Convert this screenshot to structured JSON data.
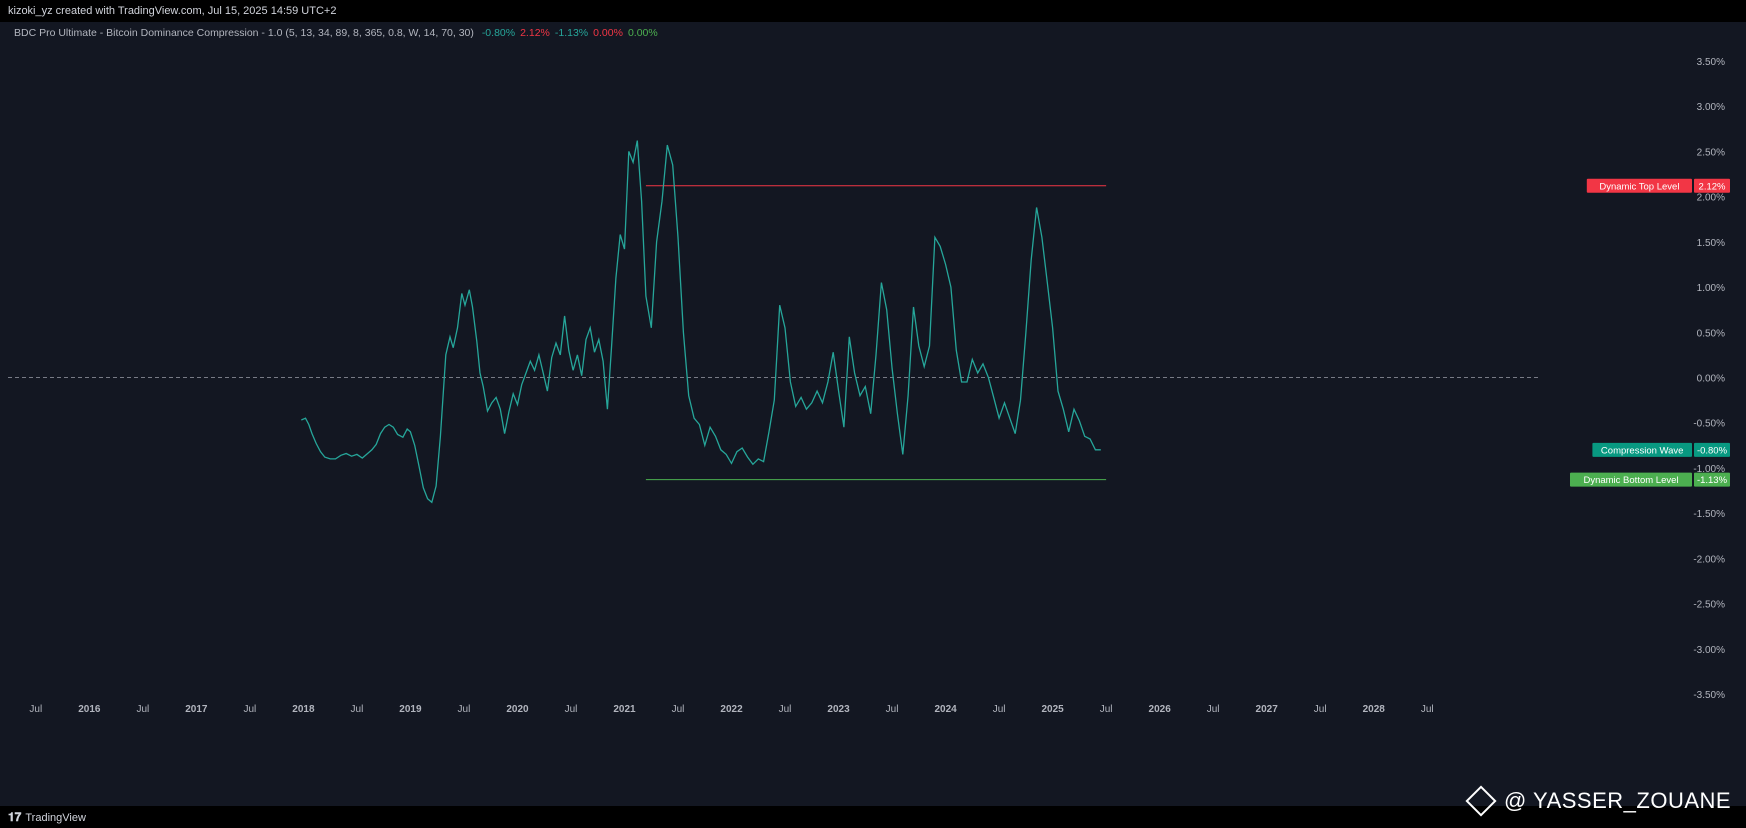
{
  "header": {
    "text": "kizoki_yz created with TradingView.com, Jul 15, 2025 14:59 UTC+2"
  },
  "legend": {
    "title": "BDC Pro Ultimate - Bitcoin Dominance Compression - 1.0 (5, 13, 34, 89, 8, 365, 0.8, W, 14, 70, 30)",
    "values": [
      {
        "text": "-0.80%",
        "color": "#26a69a"
      },
      {
        "text": "2.12%",
        "color": "#f23645"
      },
      {
        "text": "-1.13%",
        "color": "#26a69a"
      },
      {
        "text": "0.00%",
        "color": "#f23645"
      },
      {
        "text": "0.00%",
        "color": "#4caf50"
      }
    ]
  },
  "footer": {
    "logo_text": "TradingView",
    "icon": "tradingview-logo-icon"
  },
  "watermark": {
    "text": "@ YASSER_ZOUANE",
    "icon": "binance-logo-icon"
  },
  "chart_data": {
    "type": "line",
    "ylim": [
      -3.5,
      3.5
    ],
    "y_ticks": [
      "3.50%",
      "3.00%",
      "2.50%",
      "2.00%",
      "1.50%",
      "1.00%",
      "0.50%",
      "0.00%",
      "-0.50%",
      "-1.00%",
      "-1.50%",
      "-2.00%",
      "-2.50%",
      "-3.00%",
      "-3.50%"
    ],
    "x_ticks": [
      {
        "label": "Jul",
        "t": 2015.5
      },
      {
        "label": "2016",
        "t": 2016.0
      },
      {
        "label": "Jul",
        "t": 2016.5
      },
      {
        "label": "2017",
        "t": 2017.0
      },
      {
        "label": "Jul",
        "t": 2017.5
      },
      {
        "label": "2018",
        "t": 2018.0
      },
      {
        "label": "Jul",
        "t": 2018.5
      },
      {
        "label": "2019",
        "t": 2019.0
      },
      {
        "label": "Jul",
        "t": 2019.5
      },
      {
        "label": "2020",
        "t": 2020.0
      },
      {
        "label": "Jul",
        "t": 2020.5
      },
      {
        "label": "2021",
        "t": 2021.0
      },
      {
        "label": "Jul",
        "t": 2021.5
      },
      {
        "label": "2022",
        "t": 2022.0
      },
      {
        "label": "Jul",
        "t": 2022.5
      },
      {
        "label": "2023",
        "t": 2023.0
      },
      {
        "label": "Jul",
        "t": 2023.5
      },
      {
        "label": "2024",
        "t": 2024.0
      },
      {
        "label": "Jul",
        "t": 2024.5
      },
      {
        "label": "2025",
        "t": 2025.0
      },
      {
        "label": "Jul",
        "t": 2025.5
      },
      {
        "label": "2026",
        "t": 2026.0
      },
      {
        "label": "Jul",
        "t": 2026.5
      },
      {
        "label": "2027",
        "t": 2027.0
      },
      {
        "label": "Jul",
        "t": 2027.5
      },
      {
        "label": "2028",
        "t": 2028.0
      },
      {
        "label": "Jul",
        "t": 2028.5
      }
    ],
    "xlim": [
      2015.24,
      2029.18
    ],
    "zero_line": {
      "value": 0,
      "style": "dashed",
      "color": "#787b86"
    },
    "levels": [
      {
        "name": "Dynamic Top Level",
        "value": 2.12,
        "label": "2.12%",
        "color": "#f23645",
        "start": 2021.2,
        "end": 2025.5
      },
      {
        "name": "Dynamic Bottom Level",
        "value": -1.13,
        "label": "-1.13%",
        "color": "#4caf50",
        "start": 2021.2,
        "end": 2025.5
      }
    ],
    "series": [
      {
        "name": "Compression Wave",
        "label": "-0.80%",
        "color": "#26a69a",
        "points": [
          [
            2017.98,
            -0.47
          ],
          [
            2018.02,
            -0.45
          ],
          [
            2018.05,
            -0.52
          ],
          [
            2018.08,
            -0.62
          ],
          [
            2018.12,
            -0.73
          ],
          [
            2018.16,
            -0.82
          ],
          [
            2018.2,
            -0.88
          ],
          [
            2018.25,
            -0.9
          ],
          [
            2018.3,
            -0.9
          ],
          [
            2018.35,
            -0.86
          ],
          [
            2018.4,
            -0.84
          ],
          [
            2018.45,
            -0.87
          ],
          [
            2018.5,
            -0.85
          ],
          [
            2018.55,
            -0.89
          ],
          [
            2018.6,
            -0.84
          ],
          [
            2018.64,
            -0.8
          ],
          [
            2018.68,
            -0.74
          ],
          [
            2018.72,
            -0.62
          ],
          [
            2018.76,
            -0.55
          ],
          [
            2018.8,
            -0.52
          ],
          [
            2018.84,
            -0.55
          ],
          [
            2018.88,
            -0.63
          ],
          [
            2018.93,
            -0.66
          ],
          [
            2018.97,
            -0.57
          ],
          [
            2019.0,
            -0.6
          ],
          [
            2019.04,
            -0.75
          ],
          [
            2019.08,
            -0.98
          ],
          [
            2019.12,
            -1.22
          ],
          [
            2019.16,
            -1.34
          ],
          [
            2019.2,
            -1.38
          ],
          [
            2019.24,
            -1.2
          ],
          [
            2019.28,
            -0.65
          ],
          [
            2019.33,
            0.25
          ],
          [
            2019.37,
            0.45
          ],
          [
            2019.4,
            0.33
          ],
          [
            2019.44,
            0.55
          ],
          [
            2019.48,
            0.93
          ],
          [
            2019.51,
            0.8
          ],
          [
            2019.55,
            0.97
          ],
          [
            2019.58,
            0.78
          ],
          [
            2019.62,
            0.4
          ],
          [
            2019.65,
            0.05
          ],
          [
            2019.68,
            -0.1
          ],
          [
            2019.72,
            -0.37
          ],
          [
            2019.76,
            -0.28
          ],
          [
            2019.8,
            -0.22
          ],
          [
            2019.84,
            -0.35
          ],
          [
            2019.88,
            -0.62
          ],
          [
            2019.92,
            -0.38
          ],
          [
            2019.96,
            -0.18
          ],
          [
            2020.0,
            -0.3
          ],
          [
            2020.04,
            -0.08
          ],
          [
            2020.08,
            0.05
          ],
          [
            2020.12,
            0.18
          ],
          [
            2020.16,
            0.08
          ],
          [
            2020.2,
            0.25
          ],
          [
            2020.24,
            0.05
          ],
          [
            2020.28,
            -0.15
          ],
          [
            2020.32,
            0.22
          ],
          [
            2020.36,
            0.38
          ],
          [
            2020.4,
            0.25
          ],
          [
            2020.44,
            0.68
          ],
          [
            2020.48,
            0.3
          ],
          [
            2020.52,
            0.08
          ],
          [
            2020.56,
            0.25
          ],
          [
            2020.6,
            0.02
          ],
          [
            2020.64,
            0.42
          ],
          [
            2020.68,
            0.55
          ],
          [
            2020.72,
            0.28
          ],
          [
            2020.76,
            0.42
          ],
          [
            2020.8,
            0.18
          ],
          [
            2020.84,
            -0.35
          ],
          [
            2020.88,
            0.35
          ],
          [
            2020.92,
            1.1
          ],
          [
            2020.96,
            1.58
          ],
          [
            2021.0,
            1.42
          ],
          [
            2021.04,
            2.5
          ],
          [
            2021.08,
            2.38
          ],
          [
            2021.12,
            2.62
          ],
          [
            2021.16,
            1.95
          ],
          [
            2021.2,
            0.9
          ],
          [
            2021.25,
            0.55
          ],
          [
            2021.3,
            1.5
          ],
          [
            2021.35,
            1.95
          ],
          [
            2021.4,
            2.57
          ],
          [
            2021.45,
            2.35
          ],
          [
            2021.5,
            1.55
          ],
          [
            2021.55,
            0.5
          ],
          [
            2021.6,
            -0.2
          ],
          [
            2021.65,
            -0.45
          ],
          [
            2021.7,
            -0.52
          ],
          [
            2021.75,
            -0.75
          ],
          [
            2021.8,
            -0.55
          ],
          [
            2021.85,
            -0.65
          ],
          [
            2021.9,
            -0.8
          ],
          [
            2021.95,
            -0.85
          ],
          [
            2022.0,
            -0.95
          ],
          [
            2022.05,
            -0.82
          ],
          [
            2022.1,
            -0.78
          ],
          [
            2022.15,
            -0.88
          ],
          [
            2022.2,
            -0.96
          ],
          [
            2022.25,
            -0.9
          ],
          [
            2022.3,
            -0.93
          ],
          [
            2022.35,
            -0.6
          ],
          [
            2022.4,
            -0.25
          ],
          [
            2022.45,
            0.8
          ],
          [
            2022.5,
            0.55
          ],
          [
            2022.55,
            -0.05
          ],
          [
            2022.6,
            -0.32
          ],
          [
            2022.65,
            -0.22
          ],
          [
            2022.7,
            -0.35
          ],
          [
            2022.75,
            -0.28
          ],
          [
            2022.8,
            -0.15
          ],
          [
            2022.85,
            -0.28
          ],
          [
            2022.9,
            -0.05
          ],
          [
            2022.95,
            0.28
          ],
          [
            2023.0,
            -0.15
          ],
          [
            2023.05,
            -0.55
          ],
          [
            2023.1,
            0.45
          ],
          [
            2023.15,
            0.05
          ],
          [
            2023.2,
            -0.2
          ],
          [
            2023.25,
            -0.1
          ],
          [
            2023.3,
            -0.4
          ],
          [
            2023.35,
            0.25
          ],
          [
            2023.4,
            1.05
          ],
          [
            2023.45,
            0.75
          ],
          [
            2023.5,
            0.1
          ],
          [
            2023.55,
            -0.4
          ],
          [
            2023.6,
            -0.85
          ],
          [
            2023.65,
            -0.2
          ],
          [
            2023.7,
            0.78
          ],
          [
            2023.75,
            0.35
          ],
          [
            2023.8,
            0.12
          ],
          [
            2023.85,
            0.35
          ],
          [
            2023.9,
            1.55
          ],
          [
            2023.95,
            1.45
          ],
          [
            2024.0,
            1.25
          ],
          [
            2024.05,
            1.0
          ],
          [
            2024.1,
            0.3
          ],
          [
            2024.15,
            -0.05
          ],
          [
            2024.2,
            -0.05
          ],
          [
            2024.25,
            0.2
          ],
          [
            2024.3,
            0.05
          ],
          [
            2024.35,
            0.15
          ],
          [
            2024.4,
            0.0
          ],
          [
            2024.45,
            -0.22
          ],
          [
            2024.5,
            -0.45
          ],
          [
            2024.55,
            -0.28
          ],
          [
            2024.6,
            -0.45
          ],
          [
            2024.65,
            -0.62
          ],
          [
            2024.7,
            -0.25
          ],
          [
            2024.75,
            0.5
          ],
          [
            2024.8,
            1.3
          ],
          [
            2024.85,
            1.88
          ],
          [
            2024.9,
            1.55
          ],
          [
            2024.95,
            1.05
          ],
          [
            2025.0,
            0.55
          ],
          [
            2025.05,
            -0.15
          ],
          [
            2025.1,
            -0.35
          ],
          [
            2025.15,
            -0.6
          ],
          [
            2025.2,
            -0.35
          ],
          [
            2025.25,
            -0.48
          ],
          [
            2025.3,
            -0.65
          ],
          [
            2025.35,
            -0.68
          ],
          [
            2025.4,
            -0.8
          ],
          [
            2025.45,
            -0.8
          ]
        ]
      }
    ]
  }
}
